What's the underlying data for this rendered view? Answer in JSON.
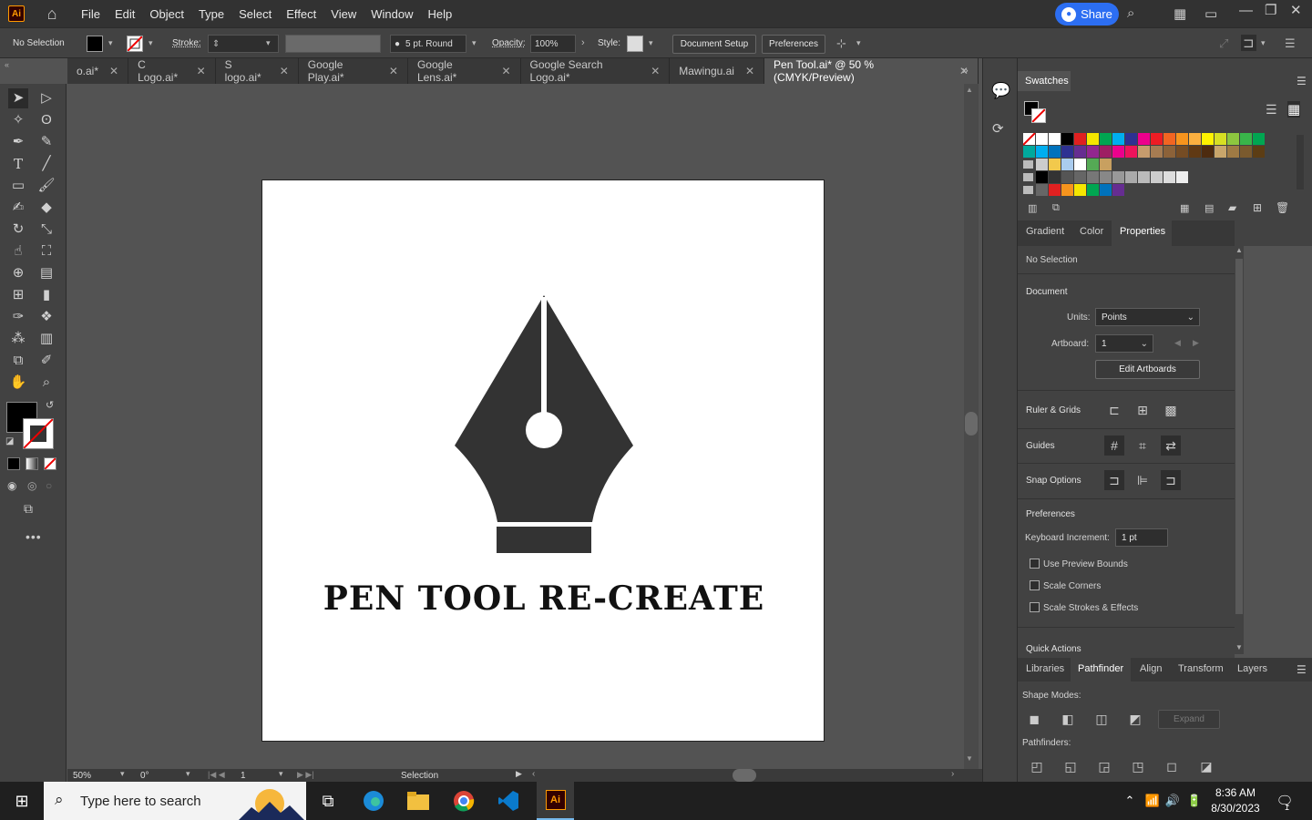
{
  "app": {
    "logo_text": "Ai",
    "menu": [
      "File",
      "Edit",
      "Object",
      "Type",
      "Select",
      "Effect",
      "View",
      "Window",
      "Help"
    ],
    "share_label": "Share"
  },
  "control_bar": {
    "selection_state": "No Selection",
    "stroke_label": "Stroke:",
    "brush_label": "5 pt. Round",
    "opacity_label": "Opacity:",
    "opacity_value": "100%",
    "style_label": "Style:",
    "document_setup_label": "Document Setup",
    "preferences_label": "Preferences"
  },
  "tabs": [
    {
      "label": "o.ai*",
      "active": false
    },
    {
      "label": "C Logo.ai*",
      "active": false
    },
    {
      "label": "S logo.ai*",
      "active": false
    },
    {
      "label": "Google Play.ai*",
      "active": false
    },
    {
      "label": "Google Lens.ai*",
      "active": false
    },
    {
      "label": "Google Search Logo.ai*",
      "active": false
    },
    {
      "label": "Mawingu.ai",
      "active": false
    },
    {
      "label": "Pen Tool.ai* @ 50 % (CMYK/Preview)",
      "active": true
    }
  ],
  "artboard": {
    "title_text": "PEN TOOL RE-CREATE"
  },
  "swatches_panel": {
    "title": "Swatches"
  },
  "properties_panel": {
    "tabs": [
      "Gradient",
      "Color",
      "Properties"
    ],
    "selection_state": "No Selection",
    "document_label": "Document",
    "units_label": "Units:",
    "units_value": "Points",
    "artboard_label": "Artboard:",
    "artboard_value": "1",
    "edit_artboards_label": "Edit Artboards",
    "ruler_grids_label": "Ruler & Grids",
    "guides_label": "Guides",
    "snap_options_label": "Snap Options",
    "preferences_label": "Preferences",
    "keyboard_increment_label": "Keyboard Increment:",
    "keyboard_increment_value": "1 pt",
    "use_preview_bounds_label": "Use Preview Bounds",
    "scale_corners_label": "Scale Corners",
    "scale_strokes_label": "Scale Strokes & Effects",
    "quick_actions_label": "Quick Actions"
  },
  "pathfinder_panel": {
    "tabs": [
      "Libraries",
      "Pathfinder",
      "Align",
      "Transform",
      "Layers"
    ],
    "shape_modes_label": "Shape Modes:",
    "expand_label": "Expand",
    "pathfinders_label": "Pathfinders:"
  },
  "status_bar": {
    "zoom_value": "50%",
    "rotation_value": "0°",
    "artboard_num": "1",
    "tool_name": "Selection"
  },
  "taskbar": {
    "search_placeholder": "Type here to search",
    "time": "8:36 AM",
    "date": "8/30/2023",
    "notification_count": "1"
  },
  "colors": {
    "accent_share": "#2c6ef2",
    "ui_dark": "#323232",
    "ui_panel": "#424242",
    "canvas_bg": "#535353",
    "artwork_fill": "#333333"
  }
}
